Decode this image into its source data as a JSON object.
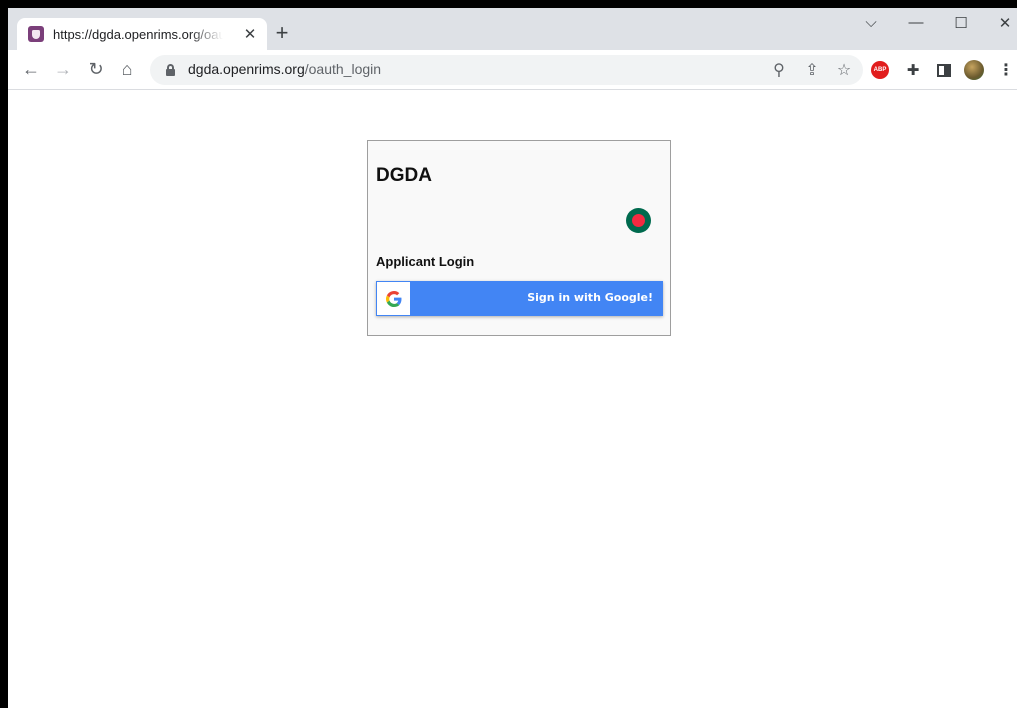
{
  "browser": {
    "tab": {
      "title": "https://dgda.openrims.org/oauth_login",
      "favicon": "rims-shield-icon"
    },
    "address_bar": {
      "host": "dgda.openrims.org",
      "path": "/oauth_login"
    },
    "icons": {
      "back": "back-arrow-icon",
      "forward": "forward-arrow-icon",
      "reload": "reload-icon",
      "home": "home-icon",
      "zoom": "zoom-icon",
      "share": "share-icon",
      "bookmark": "star-icon",
      "adblock": "adblock-plus-icon",
      "adblock_label": "ABP",
      "extensions": "puzzle-icon",
      "side_panel": "side-panel-icon",
      "profile": "profile-avatar-icon",
      "menu": "kebab-menu-icon"
    }
  },
  "login_card": {
    "brand": "DGDA",
    "heading": "Applicant Login",
    "google_button_label": "Sign in with Google!"
  },
  "colors": {
    "google_blue": "#4285f4",
    "flag_green": "#006a4e",
    "flag_red": "#f42a41"
  }
}
